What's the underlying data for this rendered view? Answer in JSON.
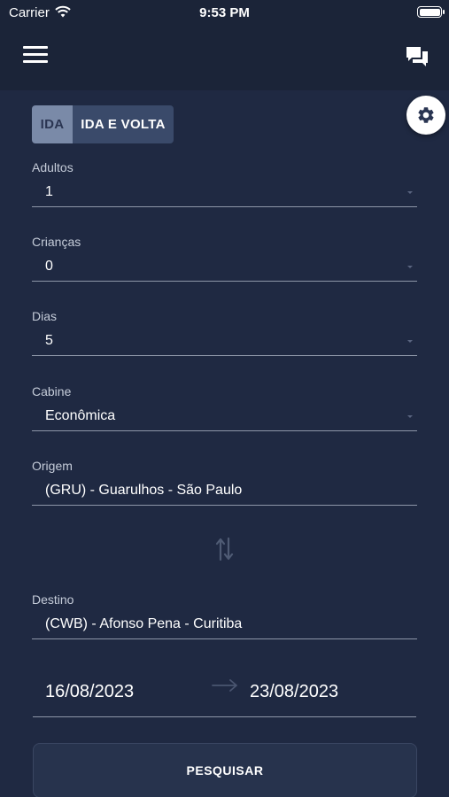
{
  "status_bar": {
    "carrier": "Carrier",
    "time": "9:53 PM",
    "icons": [
      "wifi-icon",
      "battery-icon"
    ]
  },
  "nav_bar": {
    "icons": [
      "menu-icon",
      "chat-icon"
    ]
  },
  "settings_fab": {
    "icon": "gear-icon"
  },
  "trip_type": {
    "options": [
      {
        "label": "IDA",
        "selected": true
      },
      {
        "label": "IDA E VOLTA",
        "selected": false
      }
    ]
  },
  "form": {
    "adults": {
      "label": "Adultos",
      "value": "1"
    },
    "children": {
      "label": "Crianças",
      "value": "0"
    },
    "days": {
      "label": "Dias",
      "value": "5"
    },
    "cabin": {
      "label": "Cabine",
      "value": "Econômica"
    },
    "origin": {
      "label": "Origem",
      "value": "(GRU) - Guarulhos - São Paulo"
    },
    "swap_icon": "swap-vertical-icon",
    "destination": {
      "label": "Destino",
      "value": "(CWB) - Afonso Pena - Curitiba"
    },
    "dates": {
      "start": "16/08/2023",
      "end": "23/08/2023",
      "separator_icon": "arrow-right-icon"
    }
  },
  "search_button": {
    "label": "PESQUISAR"
  },
  "colors": {
    "background": "#1f2942",
    "bar": "#1b2438",
    "toggle_selected": "#7a8aa8",
    "toggle_unselected": "#3a4a6a",
    "underline": "#8d96a8",
    "button": "#27334d"
  }
}
